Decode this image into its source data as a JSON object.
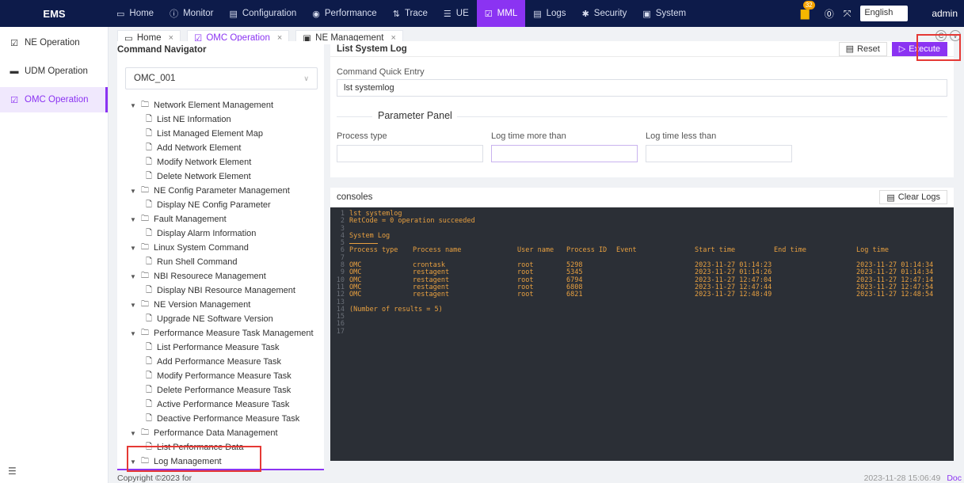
{
  "topbar": {
    "brand": "EMS",
    "nav": [
      {
        "label": "Home",
        "icon": "monitor-icon"
      },
      {
        "label": "Monitor",
        "icon": "info-circle-icon"
      },
      {
        "label": "Configuration",
        "icon": "config-doc-icon"
      },
      {
        "label": "Performance",
        "icon": "eye-icon"
      },
      {
        "label": "Trace",
        "icon": "trace-icon"
      },
      {
        "label": "UE",
        "icon": "ue-icon"
      },
      {
        "label": "MML",
        "icon": "mml-icon",
        "active": true
      },
      {
        "label": "Logs",
        "icon": "logs-icon"
      },
      {
        "label": "Security",
        "icon": "security-icon"
      },
      {
        "label": "System",
        "icon": "system-icon"
      }
    ],
    "notification_count": "32",
    "language": "English",
    "user": "admin"
  },
  "sidebar": {
    "items": [
      {
        "label": "NE Operation"
      },
      {
        "label": "UDM Operation"
      },
      {
        "label": "OMC Operation",
        "active": true
      }
    ]
  },
  "tabs": [
    {
      "label": "Home"
    },
    {
      "label": "OMC Operation",
      "active": true
    },
    {
      "label": "NE Management"
    }
  ],
  "navigator": {
    "title": "Command Navigator",
    "ne_selected": "OMC_001",
    "tree": [
      {
        "group": "Network Element Management",
        "items": [
          "List NE Information",
          "List Managed Element Map",
          "Add Network Element",
          "Modify Network Element",
          "Delete Network Element"
        ]
      },
      {
        "group": "NE Config Parameter Management",
        "items": [
          "Display NE Config Parameter"
        ]
      },
      {
        "group": "Fault Management",
        "items": [
          "Display Alarm Information"
        ]
      },
      {
        "group": "Linux System Command",
        "items": [
          "Run Shell Command"
        ]
      },
      {
        "group": "NBI Resourece Management",
        "items": [
          "Display NBI Resource Management"
        ]
      },
      {
        "group": "NE Version Management",
        "items": [
          "Upgrade NE Software Version"
        ]
      },
      {
        "group": "Performance Measure Task Management",
        "items": [
          "List Performance Measure Task",
          "Add Performance Measure Task",
          "Modify Performance Measure Task",
          "Delete Performance Measure Task",
          "Active Performance Measure Task",
          "Deactive Performance Measure Task"
        ]
      },
      {
        "group": "Performance Data Management",
        "items": [
          "List Performance Data"
        ]
      },
      {
        "group": "Log Management",
        "items": [
          "List System Log"
        ]
      }
    ]
  },
  "command": {
    "title": "List System Log",
    "reset_label": "Reset",
    "execute_label": "Execute",
    "quick_entry_label": "Command Quick Entry",
    "quick_entry_value": "lst systemlog",
    "param_panel_title": "Parameter Panel",
    "fields": [
      {
        "label": "Process type"
      },
      {
        "label": "Log time more than"
      },
      {
        "label": "Log time less than"
      }
    ]
  },
  "console": {
    "title": "consoles",
    "clear_label": "Clear Logs",
    "line1": "lst systemlog",
    "line2": "RetCode = 0 operation succeeded",
    "line4": "System Log",
    "headers": [
      "Process type",
      "Process name",
      "User name",
      "Process ID",
      "Event",
      "Start time",
      "End time",
      "Log time"
    ],
    "rows": [
      [
        "OMC",
        "crontask",
        "root",
        "5298",
        "",
        "2023-11-27 01:14:23",
        "",
        "2023-11-27 01:14:34"
      ],
      [
        "OMC",
        "restagent",
        "root",
        "5345",
        "",
        "2023-11-27 01:14:26",
        "",
        "2023-11-27 01:14:34"
      ],
      [
        "OMC",
        "restagent",
        "root",
        "6794",
        "",
        "2023-11-27 12:47:04",
        "",
        "2023-11-27 12:47:14"
      ],
      [
        "OMC",
        "restagent",
        "root",
        "6808",
        "",
        "2023-11-27 12:47:44",
        "",
        "2023-11-27 12:47:54"
      ],
      [
        "OMC",
        "restagent",
        "root",
        "6821",
        "",
        "2023-11-27 12:48:49",
        "",
        "2023-11-27 12:48:54"
      ]
    ],
    "summary": "(Number of results = 5)",
    "line_numbers": [
      "1",
      "2",
      "3",
      "4",
      "5",
      "6",
      "7",
      "8",
      "9",
      "10",
      "11",
      "12",
      "13",
      "14",
      "15",
      "16",
      "17"
    ]
  },
  "footer": {
    "copyright": "Copyright ©2023 for",
    "timestamp": "2023-11-28 15:06:49",
    "doc_label": "Doc"
  }
}
